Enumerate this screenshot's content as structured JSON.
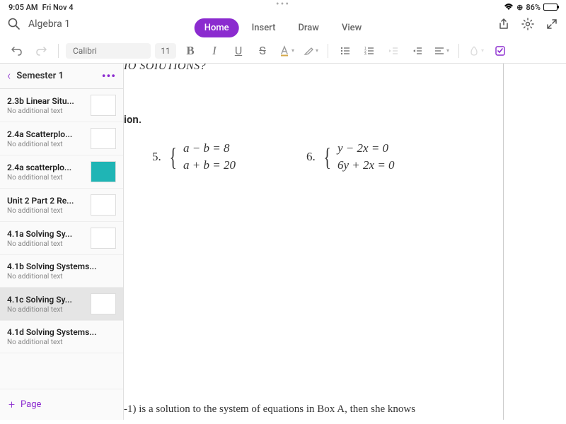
{
  "status": {
    "time": "9:05 AM",
    "date": "Fri Nov 4",
    "battery_pct": "86%"
  },
  "header": {
    "doc_title": "Algebra 1",
    "tabs": [
      "Home",
      "Insert",
      "Draw",
      "View"
    ],
    "active_tab": 0
  },
  "toolbar": {
    "font": "Calibri",
    "size": "11"
  },
  "sidebar": {
    "section": "Semester 1",
    "add_label": "Page",
    "no_text": "No additional text",
    "items": [
      {
        "title": "2.3b Linear Situ...",
        "thumb": true
      },
      {
        "title": "2.4a Scatterplo...",
        "thumb": true
      },
      {
        "title": "2.4a scatterplo...",
        "thumb": true,
        "teal": true
      },
      {
        "title": "Unit 2 Part 2 Re...",
        "thumb": true
      },
      {
        "title": "4.1a Solving Sy...",
        "thumb": true
      },
      {
        "title": "4.1b Solving Systems..."
      },
      {
        "title": "4.1c Solving Sy...",
        "thumb": true,
        "selected": true
      },
      {
        "title": "4.1d Solving Systems..."
      }
    ]
  },
  "canvas": {
    "cut_top": "IO SOIUTIONS?",
    "frag_ion": "ion.",
    "eq5_num": "5.",
    "eq5_l1": "a − b = 8",
    "eq5_l2": "a + b = 20",
    "eq6_num": "6.",
    "eq6_l1": "y − 2x = 0",
    "eq6_l2": "6y + 2x = 0",
    "bottom_frag": "-1) is a solution to the system of equations in Box A, then she knows"
  }
}
